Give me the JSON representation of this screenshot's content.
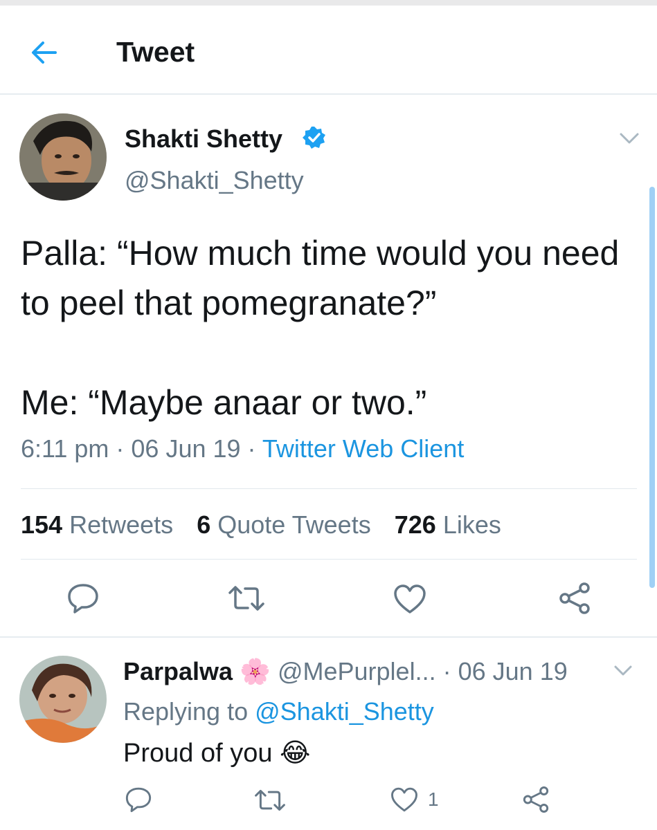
{
  "header": {
    "title": "Tweet",
    "accent": "#1da1f2"
  },
  "tweet": {
    "author_name": "Shakti Shetty",
    "author_handle": "@Shakti_Shetty",
    "verified": true,
    "text": "Palla: “How much time would you need to peel that pomegranate?”\n\nMe: “Maybe anaar or two.”",
    "time": "6:11 pm",
    "date": "06 Jun 19",
    "source": "Twitter Web Client",
    "stats": {
      "retweets_count": "154",
      "retweets_label": "Retweets",
      "quotes_count": "6",
      "quotes_label": "Quote Tweets",
      "likes_count": "726",
      "likes_label": "Likes"
    },
    "actions": [
      "reply-icon",
      "retweet-icon",
      "like-icon",
      "share-icon"
    ]
  },
  "reply": {
    "author_name": "Parpalwa",
    "author_emoji": "🌸",
    "author_handle": "@MePurplel...",
    "date": "06 Jun 19",
    "replying_to_label": "Replying to",
    "replying_to_handle": "@Shakti_Shetty",
    "text": "Proud of you",
    "text_emoji": "😂",
    "like_count": "1"
  },
  "colors": {
    "link": "#1b95e0",
    "muted": "#657786",
    "text": "#14171a",
    "verified": "#1da1f2"
  }
}
